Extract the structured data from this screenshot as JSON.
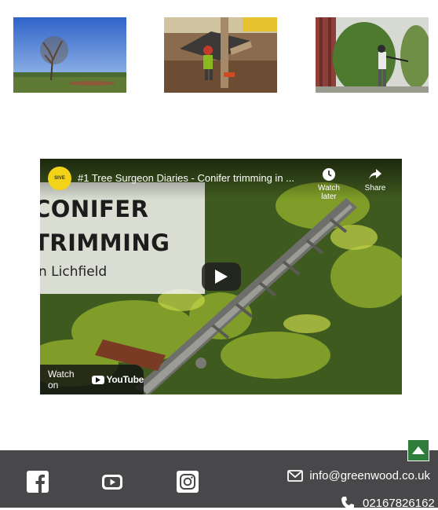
{
  "gallery": [
    {
      "alt": "park-tree-photo"
    },
    {
      "alt": "tree-surgeon-cutting-photo"
    },
    {
      "alt": "hedge-trimming-photo"
    }
  ],
  "video": {
    "channel_logo_text": "SIVE",
    "title": "#1 Tree Surgeon Diaries - Conifer trimming in ...",
    "watch_later_label": "Watch later",
    "share_label": "Share",
    "thumb_line1": "CONIFER",
    "thumb_line2": "TRIMMING",
    "thumb_line3": "n Lichfield",
    "watch_on_label": "Watch on",
    "youtube_label": "YouTube"
  },
  "footer": {
    "email": "info@greenwood.co.uk",
    "phone": "02167826162",
    "social": [
      "facebook-icon",
      "youtube-icon",
      "instagram-icon"
    ],
    "bg_color": "#48484a"
  },
  "back_to_top": {
    "color": "#2f7d3a"
  }
}
